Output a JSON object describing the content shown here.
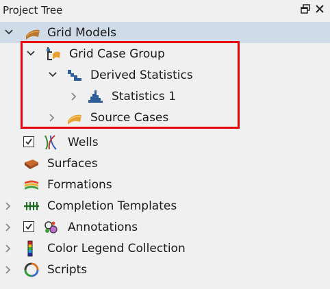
{
  "panel": {
    "title": "Project Tree"
  },
  "tree": {
    "grid_models": "Grid Models",
    "grid_case_group": "Grid Case Group",
    "derived_statistics": "Derived Statistics",
    "statistics_1": "Statistics 1",
    "source_cases": "Source Cases",
    "wells": "Wells",
    "surfaces": "Surfaces",
    "formations": "Formations",
    "completion_templates": "Completion Templates",
    "annotations": "Annotations",
    "color_legend_collection": "Color Legend Collection",
    "scripts": "Scripts"
  },
  "highlight": {
    "color": "#e8000b"
  },
  "colors": {
    "selection": "#cfdbe6",
    "background": "#f0f0f0"
  }
}
